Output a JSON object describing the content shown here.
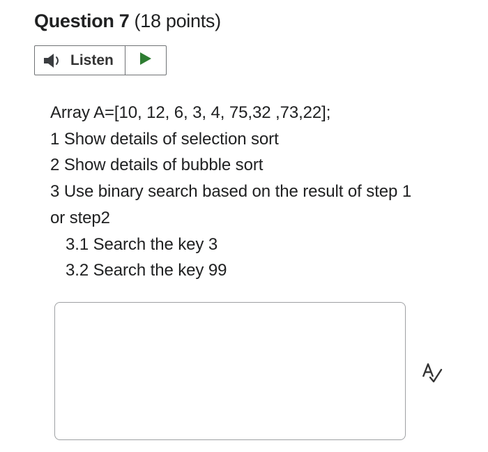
{
  "question": {
    "label": "Question 7",
    "points": "(18 points)"
  },
  "listen": {
    "label": "Listen",
    "speaker_icon": "speaker-icon",
    "play_icon": "play-icon",
    "play_color": "#2e7d32"
  },
  "body": {
    "lines": [
      "Array  A=[10, 12, 6, 3, 4, 75,32 ,73,22];",
      "1  Show details of selection sort",
      "2 Show details of bubble sort",
      "3 Use binary search based on the result of step 1",
      "or step2"
    ],
    "sub_items": [
      "3.1 Search the key 3",
      "3.2 Search the key 99"
    ]
  },
  "answer": {
    "value": "",
    "spellcheck_icon": "spellcheck-icon"
  }
}
